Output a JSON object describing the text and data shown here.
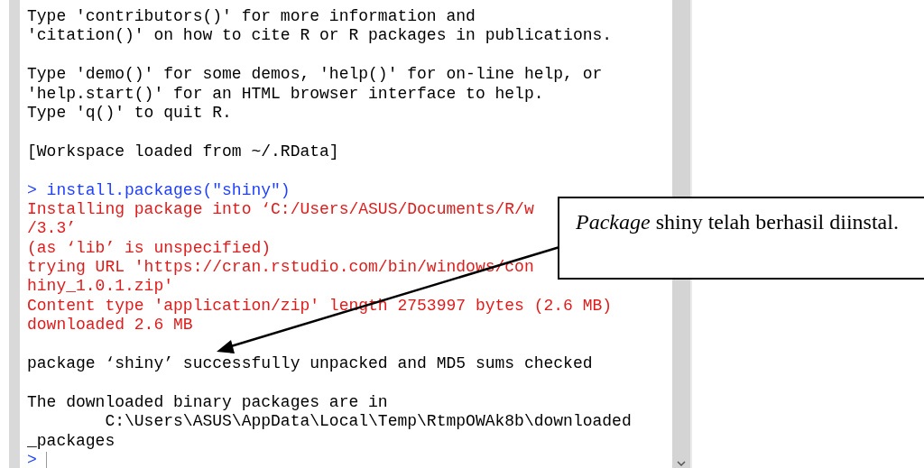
{
  "console": {
    "lines": [
      {
        "kind": "output",
        "text": "Type 'contributors()' for more information and"
      },
      {
        "kind": "output",
        "text": "'citation()' on how to cite R or R packages in publications."
      },
      {
        "kind": "blank"
      },
      {
        "kind": "output",
        "text": "Type 'demo()' for some demos, 'help()' for on-line help, or"
      },
      {
        "kind": "output",
        "text": "'help.start()' for an HTML browser interface to help."
      },
      {
        "kind": "output",
        "text": "Type 'q()' to quit R."
      },
      {
        "kind": "blank"
      },
      {
        "kind": "output",
        "text": "[Workspace loaded from ~/.RData]"
      },
      {
        "kind": "blank"
      },
      {
        "kind": "input",
        "text": "> install.packages(\"shiny\")"
      },
      {
        "kind": "message",
        "text": "Installing package into ‘C:/Users/ASUS/Documents/R/w"
      },
      {
        "kind": "message",
        "text": "/3.3’"
      },
      {
        "kind": "message",
        "text": "(as ‘lib’ is unspecified)"
      },
      {
        "kind": "message",
        "text": "trying URL 'https://cran.rstudio.com/bin/windows/con"
      },
      {
        "kind": "message",
        "text": "hiny_1.0.1.zip'"
      },
      {
        "kind": "message",
        "text": "Content type 'application/zip' length 2753997 bytes (2.6 MB)"
      },
      {
        "kind": "message",
        "text": "downloaded 2.6 MB"
      },
      {
        "kind": "blank"
      },
      {
        "kind": "output",
        "text": "package ‘shiny’ successfully unpacked and MD5 sums checked"
      },
      {
        "kind": "blank"
      },
      {
        "kind": "output",
        "text": "The downloaded binary packages are in"
      },
      {
        "kind": "output",
        "text": "        C:\\Users\\ASUS\\AppData\\Local\\Temp\\RtmpOWAk8b\\downloaded"
      },
      {
        "kind": "output",
        "text": "_packages"
      }
    ],
    "prompt": ">"
  },
  "callout": {
    "text": "*Package* shiny telah berhasil diinstal."
  }
}
